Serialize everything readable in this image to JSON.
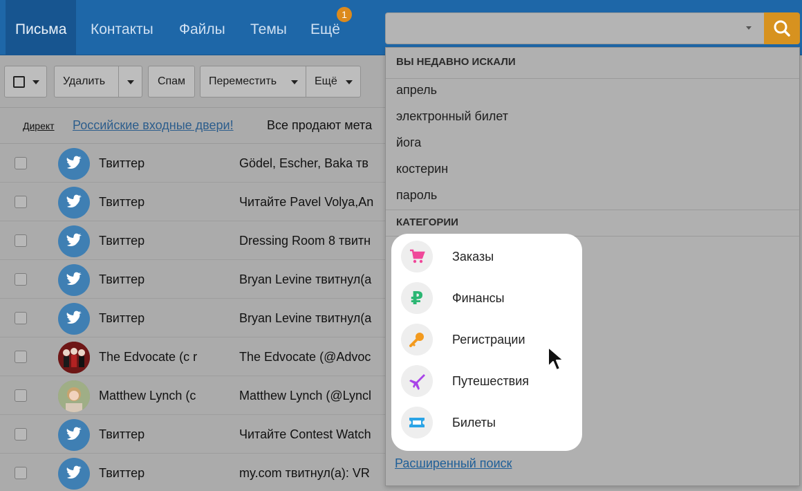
{
  "nav": {
    "tabs": [
      {
        "label": "Письма"
      },
      {
        "label": "Контакты"
      },
      {
        "label": "Файлы"
      },
      {
        "label": "Темы"
      },
      {
        "label": "Ещё"
      }
    ],
    "more_badge": "1",
    "search": {
      "value": "",
      "placeholder": ""
    }
  },
  "toolbar": {
    "delete_label": "Удалить",
    "spam_label": "Спам",
    "move_label": "Переместить",
    "more_label": "Ещё"
  },
  "ad": {
    "label": "Директ",
    "link": "Российские входные двери!",
    "text": "Все продают мета"
  },
  "emails": [
    {
      "sender": "Твиттер",
      "subject": "Gödel, Escher, Baka тв",
      "avatar": "twitter-icon"
    },
    {
      "sender": "Твиттер",
      "subject": "Читайте Pavel Volya,An",
      "avatar": "twitter-icon"
    },
    {
      "sender": "Твиттер",
      "subject": "Dressing Room 8 твитн",
      "avatar": "twitter-icon"
    },
    {
      "sender": "Твиттер",
      "subject": "Bryan Levine твитнул(а",
      "avatar": "twitter-icon"
    },
    {
      "sender": "Твиттер",
      "subject": "Bryan Levine твитнул(а",
      "avatar": "twitter-icon"
    },
    {
      "sender": "The Edvocate (c r",
      "subject": "The Edvocate (@Advoc",
      "avatar": "photo"
    },
    {
      "sender": "Matthew Lynch (c",
      "subject": "Matthew Lynch (@Lyncl",
      "avatar": "photo"
    },
    {
      "sender": "Твиттер",
      "subject": "Читайте Contest Watch",
      "avatar": "twitter-icon"
    },
    {
      "sender": "Твиттер",
      "subject": "my.com твитнул(а): VR",
      "avatar": "twitter-icon"
    }
  ],
  "dropdown": {
    "recent_header": "ВЫ НЕДАВНО ИСКАЛИ",
    "recent": [
      "апрель",
      "электронный билет",
      "йога",
      "костерин",
      "пароль"
    ],
    "categories_header": "КАТЕГОРИИ",
    "categories": [
      {
        "label": "Заказы",
        "icon": "cart-icon",
        "color": "#f0489a"
      },
      {
        "label": "Финансы",
        "icon": "ruble-icon",
        "color": "#2bb673"
      },
      {
        "label": "Регистрации",
        "icon": "key-icon",
        "color": "#f39a1e"
      },
      {
        "label": "Путешествия",
        "icon": "plane-icon",
        "color": "#a843e8"
      },
      {
        "label": "Билеты",
        "icon": "ticket-icon",
        "color": "#2ba4e6"
      }
    ],
    "advanced_link": "Расширенный поиск"
  },
  "colors": {
    "nav_bg": "#1e67a8",
    "search_button": "#d7921f",
    "badge": "#dc8a1c"
  }
}
